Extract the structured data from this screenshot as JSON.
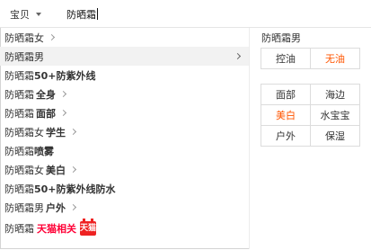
{
  "search": {
    "scope": "宝贝",
    "query": "防晒霜"
  },
  "suggestions": [
    {
      "prefix": "防晒霜女",
      "bold": "",
      "chevron": true
    },
    {
      "prefix": "防晒霜男",
      "bold": "",
      "chevron": false,
      "selected": true
    },
    {
      "prefix": "防晒霜",
      "bold": "50+防紫外线",
      "chevron": false
    },
    {
      "prefix": "防晒霜",
      "bold": " 全身",
      "chevron": true
    },
    {
      "prefix": "防晒霜",
      "bold": " 面部",
      "chevron": true
    },
    {
      "prefix": "防晒霜女",
      "bold": " 学生",
      "chevron": true
    },
    {
      "prefix": "防晒霜",
      "bold": "喷雾",
      "chevron": false
    },
    {
      "prefix": "防晒霜女",
      "bold": " 美白",
      "chevron": true
    },
    {
      "prefix": "防晒霜",
      "bold": "50+防紫外线防水",
      "chevron": false
    },
    {
      "prefix": "防晒霜男",
      "bold": " 户外",
      "chevron": true
    }
  ],
  "tmall_row": {
    "prefix": "防晒霜",
    "label": "天猫相关",
    "icon_text": "天猫",
    "icon": "tmall-cat-icon"
  },
  "panel": {
    "title": "防晒霜男",
    "group1": [
      [
        "控油",
        "无油"
      ]
    ],
    "group2": [
      [
        "面部",
        "海边"
      ],
      [
        "美白",
        "水宝宝"
      ],
      [
        "户外",
        "保湿"
      ]
    ],
    "hot_tags": [
      "无油",
      "美白"
    ]
  },
  "colors": {
    "accent": "#ff5500",
    "tmall": "#ff0036",
    "selected_bg": "#f2f2f2"
  }
}
